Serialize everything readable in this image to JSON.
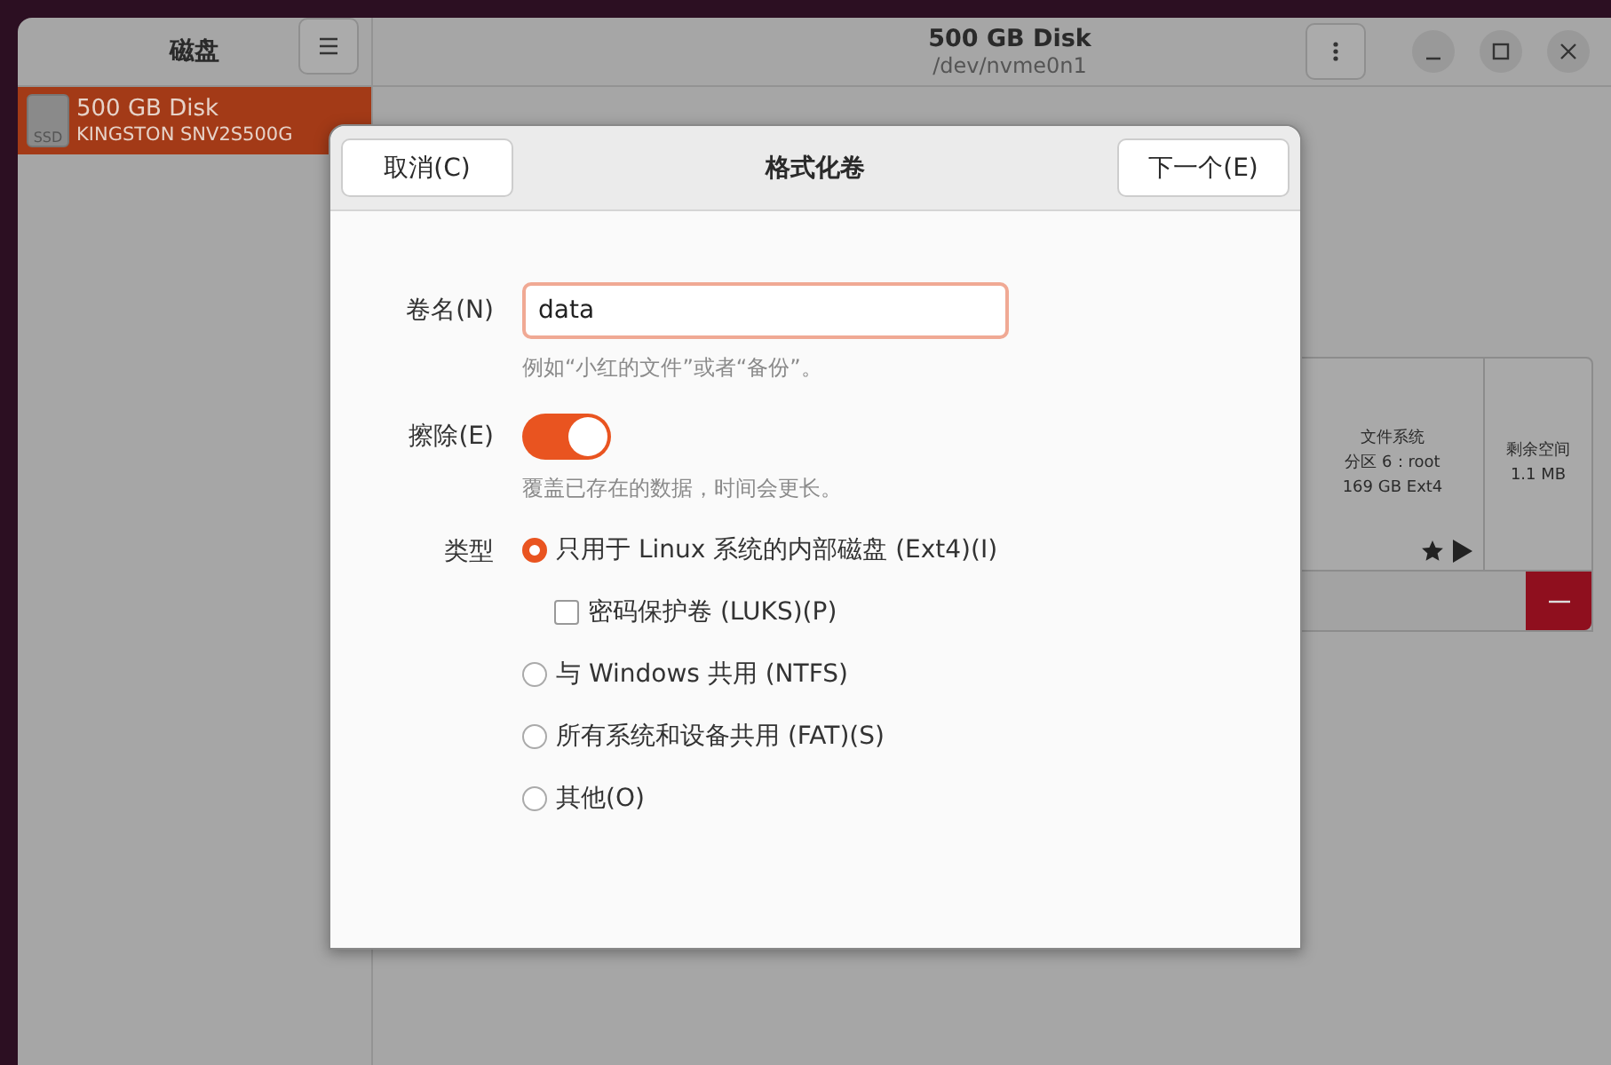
{
  "sidebar": {
    "title": "磁盘",
    "disks": [
      {
        "name": "500 GB Disk",
        "model": "KINGSTON SNV2S500G",
        "badge": "SSD",
        "selected": true
      }
    ]
  },
  "header": {
    "title": "500 GB Disk",
    "subtitle": "/dev/nvme0n1"
  },
  "partitions": [
    {
      "kind": "volume",
      "lines": [
        "文件系统",
        "分区 6：root",
        "169 GB Ext4"
      ]
    },
    {
      "kind": "free",
      "lines": [
        "剩余空间",
        "1.1 MB"
      ]
    }
  ],
  "dialog": {
    "title": "格式化卷",
    "cancel": "取消(C)",
    "next": "下一个(E)",
    "name_label": "卷名(N)",
    "name_value": "data",
    "name_hint": "例如“小红的文件”或者“备份”。",
    "erase_label": "擦除(E)",
    "erase_on": true,
    "erase_hint": "覆盖已存在的数据，时间会更长。",
    "type_label": "类型",
    "options": [
      {
        "kind": "radio",
        "label": "只用于 Linux 系统的内部磁盘 (Ext4)(I)",
        "selected": true
      },
      {
        "kind": "checkbox",
        "label": "密码保护卷 (LUKS)(P)",
        "checked": false
      },
      {
        "kind": "radio",
        "label": "与 Windows 共用 (NTFS)",
        "selected": false
      },
      {
        "kind": "radio",
        "label": "所有系统和设备共用 (FAT)(S)",
        "selected": false
      },
      {
        "kind": "radio",
        "label": "其他(O)",
        "selected": false
      }
    ]
  }
}
